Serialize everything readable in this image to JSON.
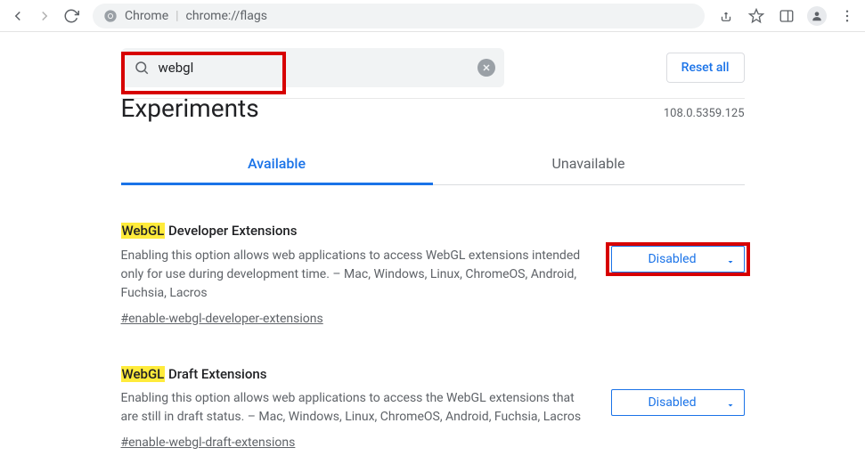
{
  "toolbar": {
    "omnibox_label": "Chrome",
    "omnibox_url": "chrome://flags"
  },
  "search": {
    "value": "webgl",
    "reset_label": "Reset all"
  },
  "header": {
    "title": "Experiments",
    "version": "108.0.5359.125"
  },
  "tabs": {
    "available": "Available",
    "unavailable": "Unavailable"
  },
  "flags": [
    {
      "highlight": "WebGL",
      "title_rest": " Developer Extensions",
      "desc": "Enabling this option allows web applications to access WebGL extensions intended only for use during development time. – Mac, Windows, Linux, ChromeOS, Android, Fuchsia, Lacros",
      "hash": "#enable-webgl-developer-extensions",
      "select": "Disabled",
      "red_box": true
    },
    {
      "highlight": "WebGL",
      "title_rest": " Draft Extensions",
      "desc": "Enabling this option allows web applications to access the WebGL extensions that are still in draft status. – Mac, Windows, Linux, ChromeOS, Android, Fuchsia, Lacros",
      "hash": "#enable-webgl-draft-extensions",
      "select": "Disabled",
      "red_box": false
    }
  ]
}
